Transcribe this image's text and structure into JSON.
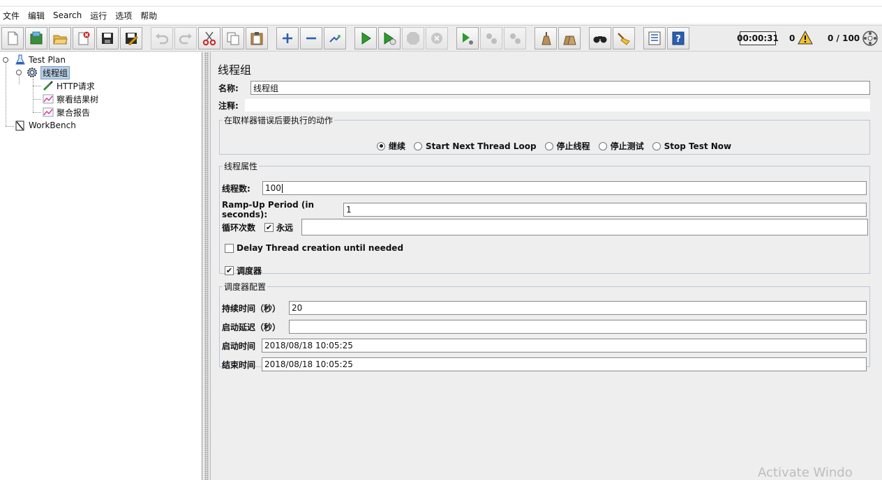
{
  "menu": [
    "文件",
    "编辑",
    "Search",
    "运行",
    "选项",
    "帮助"
  ],
  "toolbar_icons": [
    "new-icon",
    "templates-icon",
    "open-icon",
    "close-icon",
    "save-icon",
    "save-as-icon",
    "undo-icon",
    "redo-icon",
    "cut-icon",
    "copy-icon",
    "paste-icon",
    "expand-icon",
    "collapse-icon",
    "toggle-icon",
    "start-icon",
    "start-no-pause-icon",
    "stop-icon",
    "shutdown-icon",
    "remote-start-icon",
    "remote-stop-icon",
    "remote-shutdown-icon",
    "clear-icon",
    "clear-all-icon",
    "search-icon",
    "reset-search-icon",
    "function-helper-icon",
    "help-icon"
  ],
  "status": {
    "timer": "00:00:31",
    "warnings": "0",
    "threads": "0 / 100"
  },
  "tree": {
    "test_plan": "Test Plan",
    "thread_group": "线程组",
    "http_request": "HTTP请求",
    "results_tree": "察看结果树",
    "aggregate_report": "聚合报告",
    "workbench": "WorkBench"
  },
  "panel": {
    "title": "线程组",
    "name_label": "名称:",
    "name_value": "线程组",
    "comment_label": "注释:",
    "comment_value": "",
    "on_error": {
      "legend": "在取样器错误后要执行的动作",
      "options": [
        "继续",
        "Start Next Thread Loop",
        "停止线程",
        "停止测试",
        "Stop Test Now"
      ],
      "selected": 0
    },
    "thread_props": {
      "legend": "线程属性",
      "threads_label": "线程数:",
      "threads_value": "100",
      "rampup_label": "Ramp-Up Period (in seconds):",
      "rampup_value": "1",
      "loop_label": "循环次数",
      "forever_label": "永远",
      "forever_checked": true,
      "loop_value": "",
      "delay_label": "Delay Thread creation until needed",
      "delay_checked": false,
      "scheduler_label": "调度器",
      "scheduler_checked": true
    },
    "scheduler": {
      "legend": "调度器配置",
      "duration_label": "持续时间（秒）",
      "duration_value": "20",
      "delay_label": "启动延迟（秒）",
      "delay_value": "",
      "start_label": "启动时间",
      "start_value": "2018/08/18 10:05:25",
      "end_label": "结束时间",
      "end_value": "2018/08/18 10:05:25"
    }
  },
  "watermark": "Activate Windo"
}
